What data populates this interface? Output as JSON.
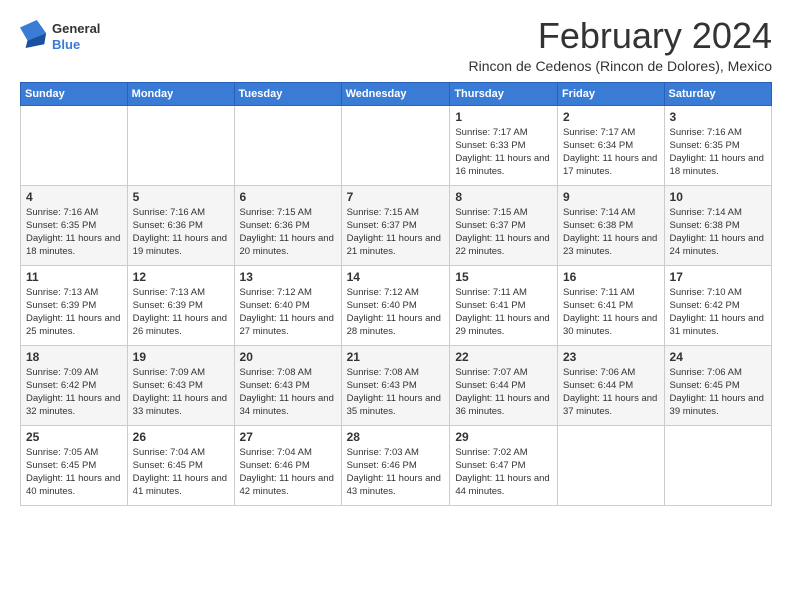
{
  "logo": {
    "general": "General",
    "blue": "Blue"
  },
  "title": "February 2024",
  "location": "Rincon de Cedenos (Rincon de Dolores), Mexico",
  "weekdays": [
    "Sunday",
    "Monday",
    "Tuesday",
    "Wednesday",
    "Thursday",
    "Friday",
    "Saturday"
  ],
  "weeks": [
    [
      {
        "day": "",
        "sunrise": "",
        "sunset": "",
        "daylight": ""
      },
      {
        "day": "",
        "sunrise": "",
        "sunset": "",
        "daylight": ""
      },
      {
        "day": "",
        "sunrise": "",
        "sunset": "",
        "daylight": ""
      },
      {
        "day": "",
        "sunrise": "",
        "sunset": "",
        "daylight": ""
      },
      {
        "day": "1",
        "sunrise": "Sunrise: 7:17 AM",
        "sunset": "Sunset: 6:33 PM",
        "daylight": "Daylight: 11 hours and 16 minutes."
      },
      {
        "day": "2",
        "sunrise": "Sunrise: 7:17 AM",
        "sunset": "Sunset: 6:34 PM",
        "daylight": "Daylight: 11 hours and 17 minutes."
      },
      {
        "day": "3",
        "sunrise": "Sunrise: 7:16 AM",
        "sunset": "Sunset: 6:35 PM",
        "daylight": "Daylight: 11 hours and 18 minutes."
      }
    ],
    [
      {
        "day": "4",
        "sunrise": "Sunrise: 7:16 AM",
        "sunset": "Sunset: 6:35 PM",
        "daylight": "Daylight: 11 hours and 18 minutes."
      },
      {
        "day": "5",
        "sunrise": "Sunrise: 7:16 AM",
        "sunset": "Sunset: 6:36 PM",
        "daylight": "Daylight: 11 hours and 19 minutes."
      },
      {
        "day": "6",
        "sunrise": "Sunrise: 7:15 AM",
        "sunset": "Sunset: 6:36 PM",
        "daylight": "Daylight: 11 hours and 20 minutes."
      },
      {
        "day": "7",
        "sunrise": "Sunrise: 7:15 AM",
        "sunset": "Sunset: 6:37 PM",
        "daylight": "Daylight: 11 hours and 21 minutes."
      },
      {
        "day": "8",
        "sunrise": "Sunrise: 7:15 AM",
        "sunset": "Sunset: 6:37 PM",
        "daylight": "Daylight: 11 hours and 22 minutes."
      },
      {
        "day": "9",
        "sunrise": "Sunrise: 7:14 AM",
        "sunset": "Sunset: 6:38 PM",
        "daylight": "Daylight: 11 hours and 23 minutes."
      },
      {
        "day": "10",
        "sunrise": "Sunrise: 7:14 AM",
        "sunset": "Sunset: 6:38 PM",
        "daylight": "Daylight: 11 hours and 24 minutes."
      }
    ],
    [
      {
        "day": "11",
        "sunrise": "Sunrise: 7:13 AM",
        "sunset": "Sunset: 6:39 PM",
        "daylight": "Daylight: 11 hours and 25 minutes."
      },
      {
        "day": "12",
        "sunrise": "Sunrise: 7:13 AM",
        "sunset": "Sunset: 6:39 PM",
        "daylight": "Daylight: 11 hours and 26 minutes."
      },
      {
        "day": "13",
        "sunrise": "Sunrise: 7:12 AM",
        "sunset": "Sunset: 6:40 PM",
        "daylight": "Daylight: 11 hours and 27 minutes."
      },
      {
        "day": "14",
        "sunrise": "Sunrise: 7:12 AM",
        "sunset": "Sunset: 6:40 PM",
        "daylight": "Daylight: 11 hours and 28 minutes."
      },
      {
        "day": "15",
        "sunrise": "Sunrise: 7:11 AM",
        "sunset": "Sunset: 6:41 PM",
        "daylight": "Daylight: 11 hours and 29 minutes."
      },
      {
        "day": "16",
        "sunrise": "Sunrise: 7:11 AM",
        "sunset": "Sunset: 6:41 PM",
        "daylight": "Daylight: 11 hours and 30 minutes."
      },
      {
        "day": "17",
        "sunrise": "Sunrise: 7:10 AM",
        "sunset": "Sunset: 6:42 PM",
        "daylight": "Daylight: 11 hours and 31 minutes."
      }
    ],
    [
      {
        "day": "18",
        "sunrise": "Sunrise: 7:09 AM",
        "sunset": "Sunset: 6:42 PM",
        "daylight": "Daylight: 11 hours and 32 minutes."
      },
      {
        "day": "19",
        "sunrise": "Sunrise: 7:09 AM",
        "sunset": "Sunset: 6:43 PM",
        "daylight": "Daylight: 11 hours and 33 minutes."
      },
      {
        "day": "20",
        "sunrise": "Sunrise: 7:08 AM",
        "sunset": "Sunset: 6:43 PM",
        "daylight": "Daylight: 11 hours and 34 minutes."
      },
      {
        "day": "21",
        "sunrise": "Sunrise: 7:08 AM",
        "sunset": "Sunset: 6:43 PM",
        "daylight": "Daylight: 11 hours and 35 minutes."
      },
      {
        "day": "22",
        "sunrise": "Sunrise: 7:07 AM",
        "sunset": "Sunset: 6:44 PM",
        "daylight": "Daylight: 11 hours and 36 minutes."
      },
      {
        "day": "23",
        "sunrise": "Sunrise: 7:06 AM",
        "sunset": "Sunset: 6:44 PM",
        "daylight": "Daylight: 11 hours and 37 minutes."
      },
      {
        "day": "24",
        "sunrise": "Sunrise: 7:06 AM",
        "sunset": "Sunset: 6:45 PM",
        "daylight": "Daylight: 11 hours and 39 minutes."
      }
    ],
    [
      {
        "day": "25",
        "sunrise": "Sunrise: 7:05 AM",
        "sunset": "Sunset: 6:45 PM",
        "daylight": "Daylight: 11 hours and 40 minutes."
      },
      {
        "day": "26",
        "sunrise": "Sunrise: 7:04 AM",
        "sunset": "Sunset: 6:45 PM",
        "daylight": "Daylight: 11 hours and 41 minutes."
      },
      {
        "day": "27",
        "sunrise": "Sunrise: 7:04 AM",
        "sunset": "Sunset: 6:46 PM",
        "daylight": "Daylight: 11 hours and 42 minutes."
      },
      {
        "day": "28",
        "sunrise": "Sunrise: 7:03 AM",
        "sunset": "Sunset: 6:46 PM",
        "daylight": "Daylight: 11 hours and 43 minutes."
      },
      {
        "day": "29",
        "sunrise": "Sunrise: 7:02 AM",
        "sunset": "Sunset: 6:47 PM",
        "daylight": "Daylight: 11 hours and 44 minutes."
      },
      {
        "day": "",
        "sunrise": "",
        "sunset": "",
        "daylight": ""
      },
      {
        "day": "",
        "sunrise": "",
        "sunset": "",
        "daylight": ""
      }
    ]
  ]
}
